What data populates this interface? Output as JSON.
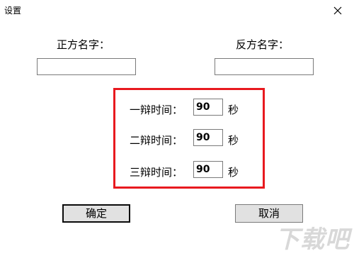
{
  "window": {
    "title": "设置",
    "close_icon": "close-icon"
  },
  "names": {
    "pro_label": "正方名字：",
    "pro_value": "",
    "con_label": "反方名字：",
    "con_value": ""
  },
  "debate": {
    "rounds": [
      {
        "label": "一辩时间：",
        "value": "90",
        "unit": "秒"
      },
      {
        "label": "二辩时间：",
        "value": "90",
        "unit": "秒"
      },
      {
        "label": "三辩时间：",
        "value": "90",
        "unit": "秒"
      }
    ],
    "highlight_color": "#e8191f"
  },
  "buttons": {
    "ok_label": "确定",
    "cancel_label": "取消"
  },
  "watermark": {
    "text": "下载吧"
  }
}
